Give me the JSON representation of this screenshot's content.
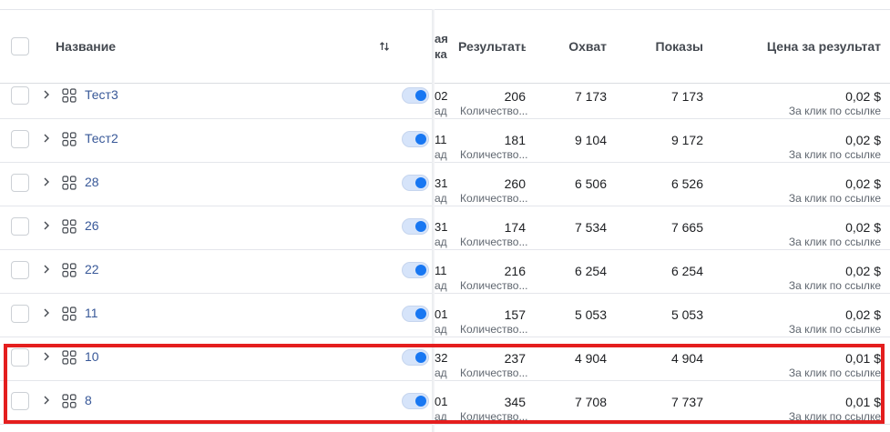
{
  "header": {
    "name_label": "Название",
    "partial_top": "ая",
    "partial_bottom": "ка",
    "result_label": "Результаты",
    "reach_label": "Охват",
    "impressions_label": "Показы",
    "cost_label": "Цена за результат",
    "sort_icon": "sort-arrows-icon"
  },
  "rows": [
    {
      "name": "Тест3",
      "partial_top": "02",
      "partial_bottom": "ад",
      "result": "206",
      "result_type": "Количество...",
      "reach": "7 173",
      "impressions": "7 173",
      "cost": "0,02 $",
      "cost_type": "За клик по ссылке"
    },
    {
      "name": "Тест2",
      "partial_top": "11",
      "partial_bottom": "ад",
      "result": "181",
      "result_type": "Количество...",
      "reach": "9 104",
      "impressions": "9 172",
      "cost": "0,02 $",
      "cost_type": "За клик по ссылке"
    },
    {
      "name": "28",
      "partial_top": "31",
      "partial_bottom": "ад",
      "result": "260",
      "result_type": "Количество...",
      "reach": "6 506",
      "impressions": "6 526",
      "cost": "0,02 $",
      "cost_type": "За клик по ссылке"
    },
    {
      "name": "26",
      "partial_top": "31",
      "partial_bottom": "ад",
      "result": "174",
      "result_type": "Количество...",
      "reach": "7 534",
      "impressions": "7 665",
      "cost": "0,02 $",
      "cost_type": "За клик по ссылке"
    },
    {
      "name": "22",
      "partial_top": "11",
      "partial_bottom": "ад",
      "result": "216",
      "result_type": "Количество...",
      "reach": "6 254",
      "impressions": "6 254",
      "cost": "0,02 $",
      "cost_type": "За клик по ссылке"
    },
    {
      "name": "11",
      "partial_top": "01",
      "partial_bottom": "ад",
      "result": "157",
      "result_type": "Количество...",
      "reach": "5 053",
      "impressions": "5 053",
      "cost": "0,02 $",
      "cost_type": "За клик по ссылке"
    },
    {
      "name": "10",
      "partial_top": "32",
      "partial_bottom": "ад",
      "result": "237",
      "result_type": "Количество...",
      "reach": "4 904",
      "impressions": "4 904",
      "cost": "0,01 $",
      "cost_type": "За клик по ссылке"
    },
    {
      "name": "8",
      "partial_top": "01",
      "partial_bottom": "ад",
      "result": "345",
      "result_type": "Количество...",
      "reach": "7 708",
      "impressions": "7 737",
      "cost": "0,01 $",
      "cost_type": "За клик по ссылке"
    }
  ],
  "colors": {
    "link": "#385898",
    "highlight": "#e41e1e",
    "toggle": "#1877f2"
  }
}
